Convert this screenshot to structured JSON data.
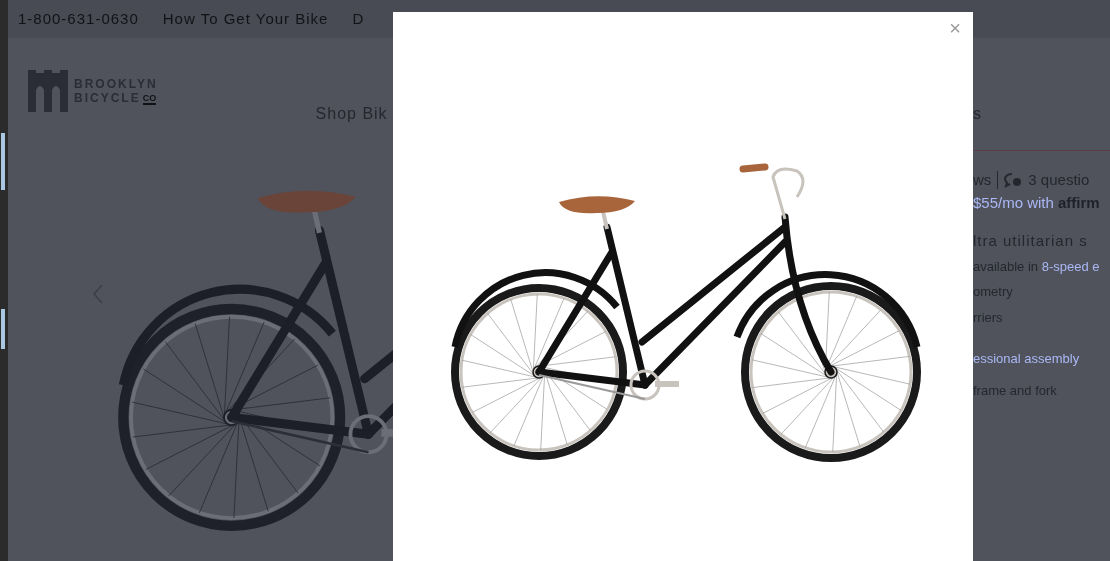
{
  "top_bar": {
    "phone": "1-800-631-0630",
    "links": [
      "How To Get Your Bike",
      "D"
    ]
  },
  "logo": {
    "lines": [
      "BROOKLYN",
      "BICYCLE"
    ],
    "suffix": "CO"
  },
  "nav": {
    "items": [
      "Shop Bik",
      "s"
    ]
  },
  "product": {
    "reviews": "ws",
    "questions": "3 questio",
    "financing": "$55/mo with",
    "financing_brand": "affirm",
    "headline": "ltra utilitarian s",
    "features": [
      {
        "text": "available in ",
        "link": "8-speed e"
      },
      {
        "text": "ometry"
      },
      {
        "text": "rriers"
      },
      {
        "link": "essional assembly"
      },
      {
        "text": "frame and fork"
      }
    ]
  },
  "modal": {
    "close": "×"
  }
}
